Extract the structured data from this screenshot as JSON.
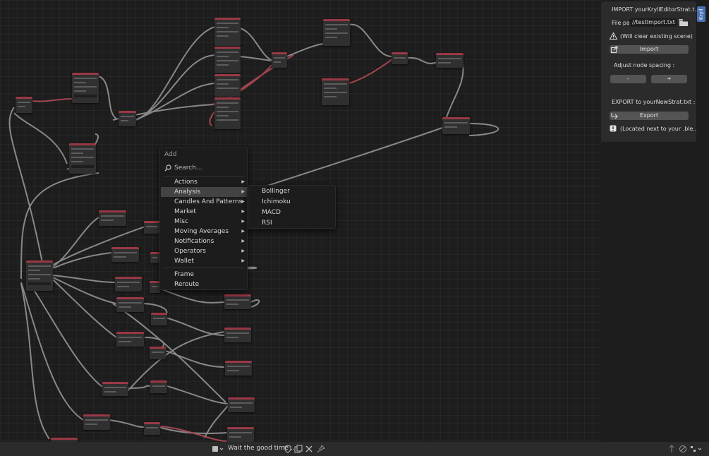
{
  "add_menu": {
    "title": "Add",
    "search_placeholder": "Search...",
    "items": [
      {
        "label": "Actions",
        "has_submenu": true
      },
      {
        "label": "Analysis",
        "has_submenu": true,
        "active": true
      },
      {
        "label": "Candles And Patterns",
        "has_submenu": true
      },
      {
        "label": "Market",
        "has_submenu": true
      },
      {
        "label": "Misc",
        "has_submenu": true
      },
      {
        "label": "Moving Averages",
        "has_submenu": true
      },
      {
        "label": "Notifications",
        "has_submenu": true
      },
      {
        "label": "Operators",
        "has_submenu": true
      },
      {
        "label": "Wallet",
        "has_submenu": true
      }
    ],
    "extra_items": [
      {
        "label": "Frame"
      },
      {
        "label": "Reroute"
      }
    ]
  },
  "analysis_submenu": {
    "items": [
      {
        "label": "Bollinger"
      },
      {
        "label": "Ichimoku"
      },
      {
        "label": "MACD"
      },
      {
        "label": "RSI"
      }
    ]
  },
  "side_panel": {
    "tab_label": "Kryll",
    "import_title": "IMPORT yourKryllEditorStrat.t..",
    "file_path_label": "File pa",
    "file_path_value": "//testImport.txt",
    "warning_text": "(Will clear existing scene)",
    "import_button": "Import",
    "spacing_label": "Adjust node spacing :",
    "minus_button": "-",
    "plus_button": "+",
    "export_title": "EXPORT to yourNewStrat.txt :",
    "export_button": "Export",
    "info_text": "(Located next to your .ble.."
  },
  "status_bar": {
    "message": "Wait the good time .."
  },
  "colors": {
    "node_header": "#9a3845",
    "wire": "#9b9b9b",
    "wire_selected": "#b04a55",
    "menu_bg": "#1c1c1c",
    "menu_highlight": "#434343",
    "panel_bg": "#2b2b2b",
    "tab_accent": "#4772b3"
  }
}
